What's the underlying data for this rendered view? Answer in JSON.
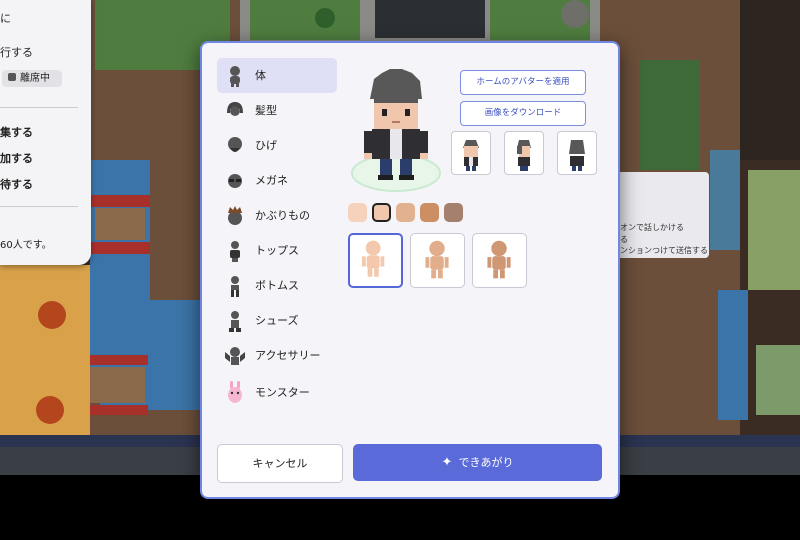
{
  "side_panel": {
    "partial_items": [
      "に",
      "行する",
      "集する",
      "加する",
      "待する",
      "60人です。"
    ],
    "status_label": "離席中"
  },
  "tooltip": {
    "lines": [
      "オンで話しかける",
      "る",
      "ンションつけて送信する"
    ]
  },
  "modal": {
    "categories": [
      {
        "label": "体",
        "icon": "body-icon"
      },
      {
        "label": "髪型",
        "icon": "hair-icon"
      },
      {
        "label": "ひげ",
        "icon": "beard-icon"
      },
      {
        "label": "メガネ",
        "icon": "glasses-icon"
      },
      {
        "label": "かぶりもの",
        "icon": "hat-icon"
      },
      {
        "label": "トップス",
        "icon": "tops-icon"
      },
      {
        "label": "ボトムス",
        "icon": "bottoms-icon"
      },
      {
        "label": "シューズ",
        "icon": "shoes-icon"
      },
      {
        "label": "アクセサリー",
        "icon": "accessory-icon"
      },
      {
        "label": "モンスター",
        "icon": "monster-icon"
      }
    ],
    "active_category": "体",
    "apply_home_avatar_label": "ホームのアバターを適用",
    "download_image_label": "画像をダウンロード",
    "direction_views": [
      "front",
      "side",
      "back"
    ],
    "skin_colors": [
      "#f6d2bd",
      "#f0c7ac",
      "#e2b18f",
      "#cc8f64",
      "#a6806f"
    ],
    "selected_skin_index": 1,
    "body_types": [
      "light",
      "medium",
      "tan"
    ],
    "selected_body_index": 0,
    "cancel_label": "キャンセル",
    "done_label": "できあがり"
  }
}
